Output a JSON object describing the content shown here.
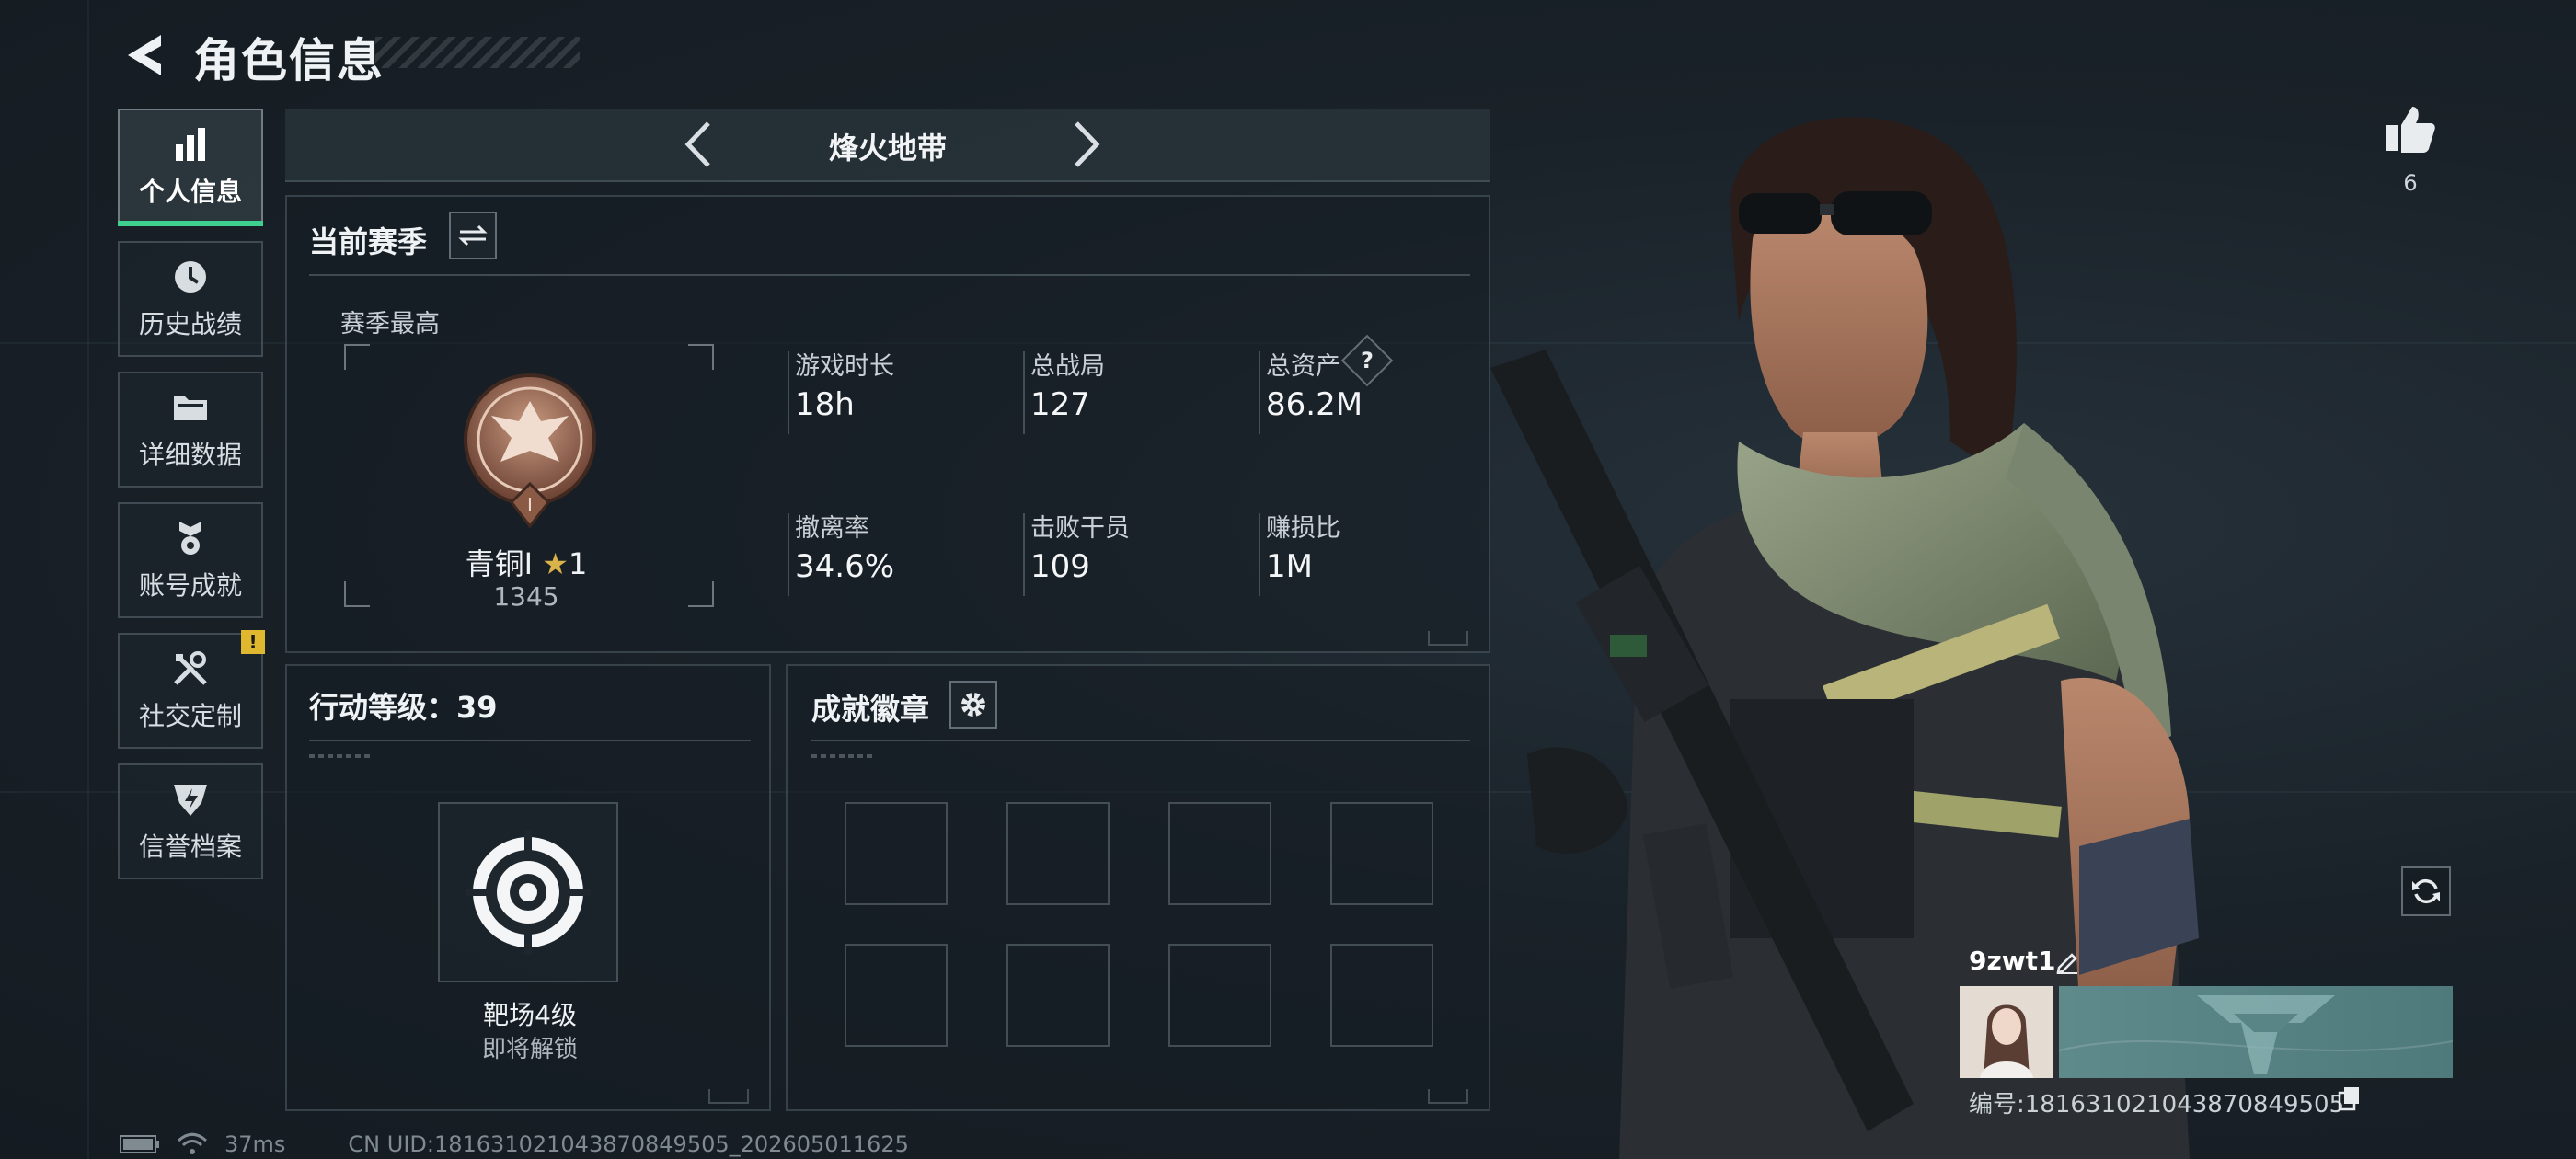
{
  "header": {
    "title": "角色信息",
    "back_icon": "back-arrow-icon"
  },
  "sidebar": {
    "items": [
      {
        "label": "个人信息",
        "icon": "bar-chart-icon",
        "active": true
      },
      {
        "label": "历史战绩",
        "icon": "history-clock-icon",
        "active": false
      },
      {
        "label": "详细数据",
        "icon": "folder-icon",
        "active": false
      },
      {
        "label": "账号成就",
        "icon": "medal-icon",
        "active": false
      },
      {
        "label": "社交定制",
        "icon": "tools-icon",
        "active": false,
        "badge": "!"
      },
      {
        "label": "信誉档案",
        "icon": "shield-bolt-icon",
        "active": false
      }
    ]
  },
  "mode": {
    "name": "烽火地带"
  },
  "season": {
    "title": "当前赛季",
    "highest_label": "赛季最高",
    "rank_name": "青铜I",
    "rank_stars": "1",
    "rank_points": "1345",
    "stats": [
      {
        "label": "游戏时长",
        "value": "18h"
      },
      {
        "label": "总战局",
        "value": "127"
      },
      {
        "label": "总资产",
        "value": "86.2M",
        "help": "?"
      },
      {
        "label": "撤离率",
        "value": "34.6%"
      },
      {
        "label": "击败干员",
        "value": "109"
      },
      {
        "label": "赚损比",
        "value": "1M"
      }
    ]
  },
  "action_level": {
    "title": "行动等级：39",
    "reward_name": "靶场4级",
    "reward_status": "即将解锁"
  },
  "achievements": {
    "title": "成就徽章",
    "slots": 8
  },
  "profile": {
    "likes": "6",
    "player_name": "9zwt1",
    "player_id": "编号:181631021043870849505"
  },
  "status": {
    "ping": "37ms",
    "uid": "CN UID:181631021043870849505_202605011625"
  },
  "colors": {
    "accent": "#3fd08f",
    "warning": "#e0b830",
    "bronze": "#8a5a45"
  }
}
